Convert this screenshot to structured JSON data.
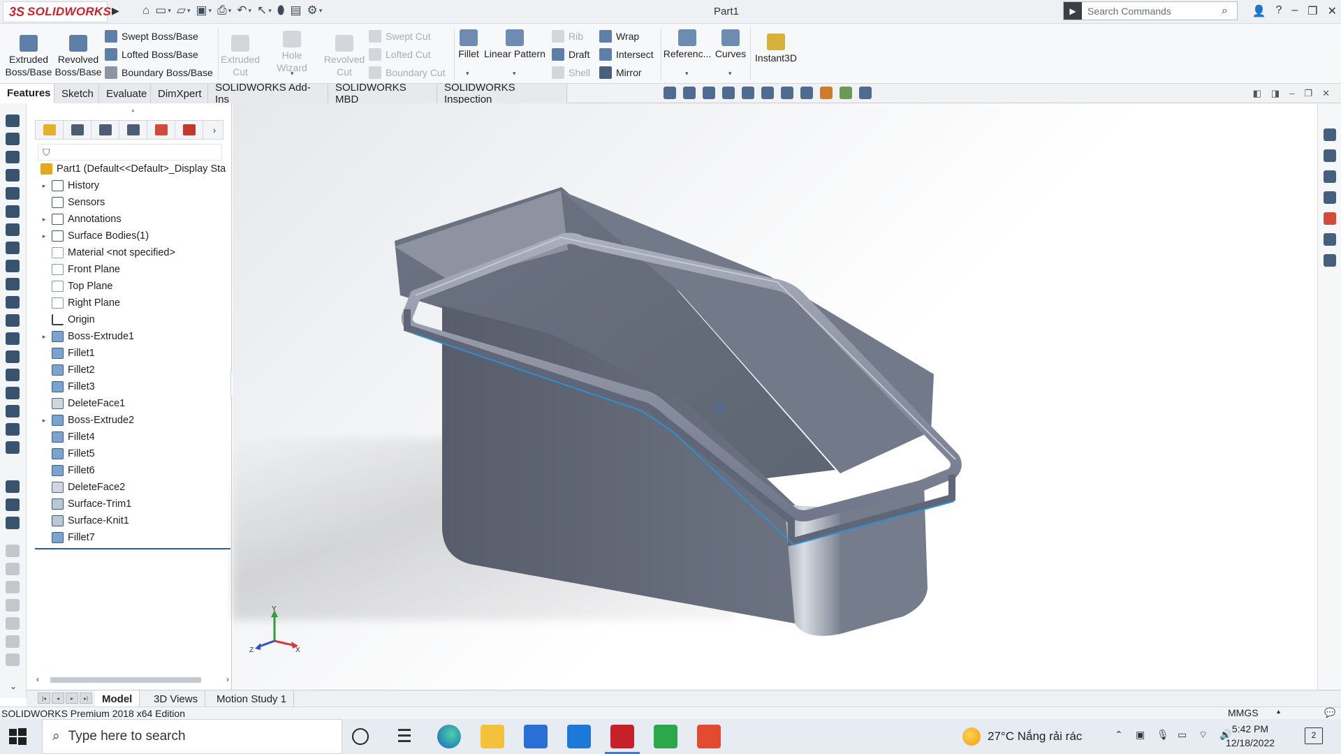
{
  "app": {
    "logo_ds": "3S",
    "logo_name": "SOLIDWORKS",
    "document_title": "Part1",
    "search_placeholder": "Search Commands"
  },
  "ribbon": {
    "extruded_boss": "Extruded Boss/Base",
    "revolved_boss": "Revolved Boss/Base",
    "swept_boss": "Swept Boss/Base",
    "lofted_boss": "Lofted Boss/Base",
    "boundary_boss": "Boundary Boss/Base",
    "extruded_cut": "Extruded Cut",
    "hole_wizard": "Hole Wizard",
    "revolved_cut": "Revolved Cut",
    "swept_cut": "Swept Cut",
    "lofted_cut": "Lofted Cut",
    "boundary_cut": "Boundary Cut",
    "fillet": "Fillet",
    "linear_pattern": "Linear Pattern",
    "rib": "Rib",
    "draft": "Draft",
    "shell": "Shell",
    "wrap": "Wrap",
    "intersect": "Intersect",
    "mirror": "Mirror",
    "reference": "Referenc...",
    "curves": "Curves",
    "instant3d": "Instant3D"
  },
  "tabs": [
    "Features",
    "Sketch",
    "Evaluate",
    "DimXpert",
    "SOLIDWORKS Add-Ins",
    "SOLIDWORKS MBD",
    "SOLIDWORKS Inspection"
  ],
  "tree": {
    "root": "Part1  (Default<<Default>_Display Sta",
    "items": [
      {
        "label": "History",
        "icon": "folder",
        "expand": "▸"
      },
      {
        "label": "Sensors",
        "icon": "folder",
        "expand": ""
      },
      {
        "label": "Annotations",
        "icon": "folder",
        "expand": "▸"
      },
      {
        "label": "Surface Bodies(1)",
        "icon": "folder",
        "expand": "▸"
      },
      {
        "label": "Material <not specified>",
        "icon": "mat",
        "expand": ""
      },
      {
        "label": "Front Plane",
        "icon": "plane",
        "expand": ""
      },
      {
        "label": "Top Plane",
        "icon": "plane",
        "expand": ""
      },
      {
        "label": "Right Plane",
        "icon": "plane",
        "expand": ""
      },
      {
        "label": "Origin",
        "icon": "origin",
        "expand": ""
      },
      {
        "label": "Boss-Extrude1",
        "icon": "feat",
        "expand": "▸"
      },
      {
        "label": "Fillet1",
        "icon": "feat",
        "expand": ""
      },
      {
        "label": "Fillet2",
        "icon": "feat",
        "expand": ""
      },
      {
        "label": "Fillet3",
        "icon": "feat",
        "expand": ""
      },
      {
        "label": "DeleteFace1",
        "icon": "del",
        "expand": ""
      },
      {
        "label": "Boss-Extrude2",
        "icon": "feat",
        "expand": "▸"
      },
      {
        "label": "Fillet4",
        "icon": "feat",
        "expand": ""
      },
      {
        "label": "Fillet5",
        "icon": "feat",
        "expand": ""
      },
      {
        "label": "Fillet6",
        "icon": "feat",
        "expand": ""
      },
      {
        "label": "DeleteFace2",
        "icon": "del",
        "expand": ""
      },
      {
        "label": "Surface-Trim1",
        "icon": "surf",
        "expand": ""
      },
      {
        "label": "Surface-Knit1",
        "icon": "surf",
        "expand": ""
      },
      {
        "label": "Fillet7",
        "icon": "feat",
        "expand": ""
      }
    ]
  },
  "bottom_tabs": [
    "Model",
    "3D Views",
    "Motion Study 1"
  ],
  "status": {
    "edition": "SOLIDWORKS Premium 2018 x64 Edition",
    "units": "MMGS"
  },
  "triad": {
    "x": "X",
    "y": "Y",
    "z": "Z"
  },
  "taskbar": {
    "search_placeholder": "Type here to search",
    "weather": "27°C  Nắng rải rác",
    "time": "5:42 PM",
    "date": "12/18/2022",
    "notifications": "2"
  },
  "colors": {
    "brand_red": "#d0202a",
    "model_gray": "#6e7584",
    "edge_blue": "#2f8fd0"
  }
}
